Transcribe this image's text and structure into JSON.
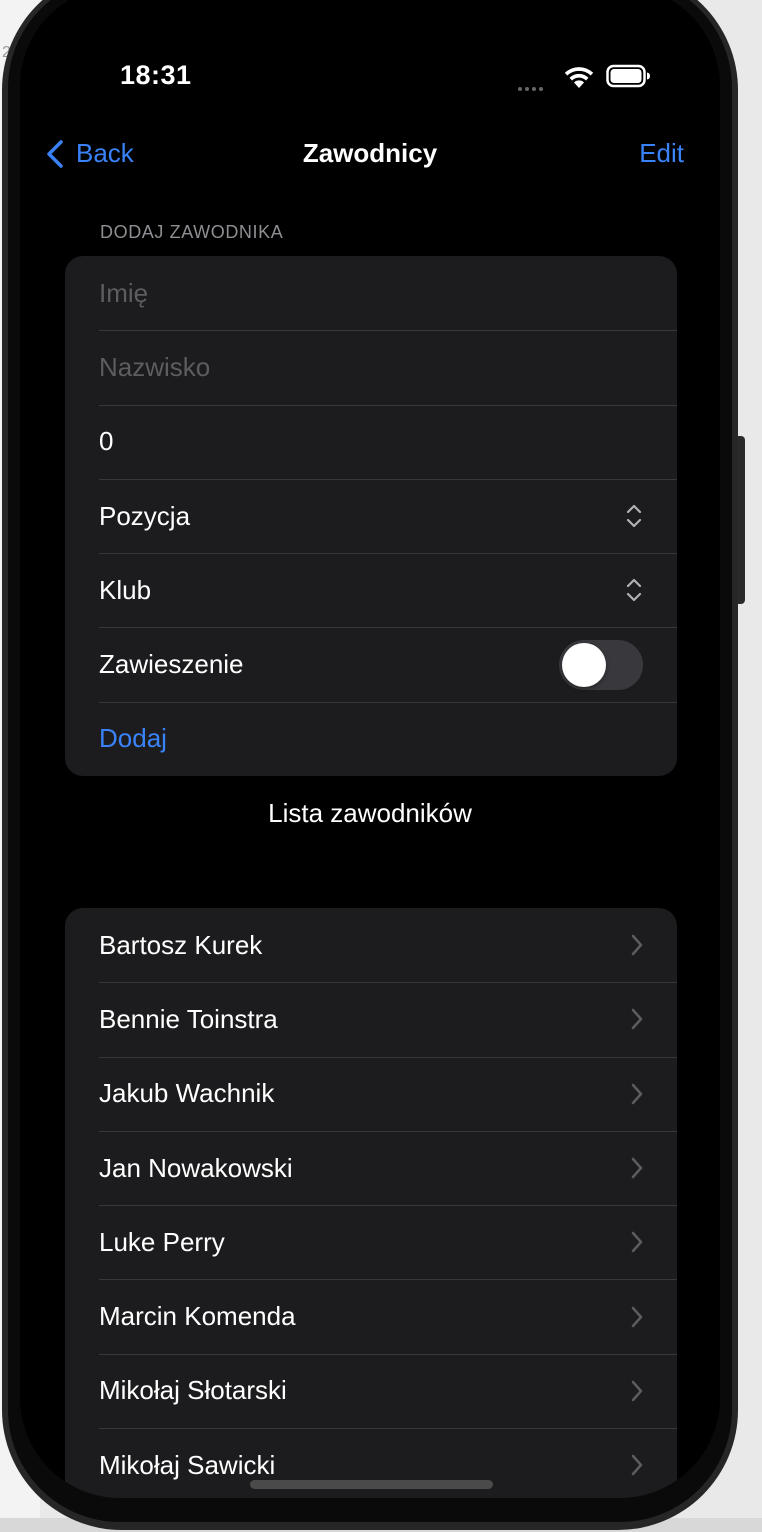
{
  "background_window": {
    "tab_text": "2a"
  },
  "status_bar": {
    "time": "18:31"
  },
  "nav": {
    "back_label": "Back",
    "title": "Zawodnicy",
    "edit_label": "Edit"
  },
  "add_form": {
    "section_header": "DODAJ ZAWODNIKA",
    "first_name_placeholder": "Imię",
    "last_name_placeholder": "Nazwisko",
    "number_value": "0",
    "position_label": "Pozycja",
    "club_label": "Klub",
    "suspension_label": "Zawieszenie",
    "suspension_on": false,
    "add_button_label": "Dodaj"
  },
  "list": {
    "heading": "Lista zawodników",
    "players": [
      "Bartosz Kurek",
      "Bennie Toinstra",
      "Jakub Wachnik",
      "Jan Nowakowski",
      "Luke Perry",
      "Marcin Komenda",
      "Mikołaj Słotarski",
      "Mikołaj Sawicki"
    ]
  },
  "colors": {
    "accent": "#3a82f7",
    "background": "#000000",
    "card": "#1c1c1e",
    "separator": "#38383a"
  }
}
